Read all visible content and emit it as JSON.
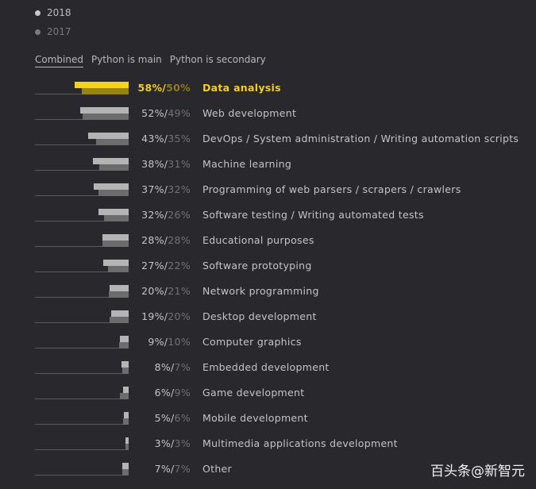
{
  "legend": [
    {
      "label": "2018",
      "color": "#c8c8c8"
    },
    {
      "label": "2017",
      "color": "#7a7a7a"
    }
  ],
  "tabs": [
    {
      "label": "Combined",
      "active": true
    },
    {
      "label": "Python is main",
      "active": false
    },
    {
      "label": "Python is secondary",
      "active": false
    }
  ],
  "watermark": "百头条@新智元",
  "chart_data": {
    "type": "bar",
    "orientation": "horizontal",
    "series": [
      {
        "name": "2018",
        "color": "#b4b4b4",
        "highlight_color": "#f5d31a"
      },
      {
        "name": "2017",
        "color": "#6c6c6c",
        "highlight_color": "#9a8212"
      }
    ],
    "categories": [
      "Data analysis",
      "Web development",
      "DevOps / System administration / Writing automation scripts",
      "Machine learning",
      "Programming of web parsers / scrapers / crawlers",
      "Software testing / Writing automated tests",
      "Educational purposes",
      "Software prototyping",
      "Network programming",
      "Desktop development",
      "Computer graphics",
      "Embedded development",
      "Game development",
      "Mobile development",
      "Multimedia applications development",
      "Other"
    ],
    "values_2018": [
      58,
      52,
      43,
      38,
      37,
      32,
      28,
      27,
      20,
      19,
      9,
      8,
      6,
      5,
      3,
      7
    ],
    "values_2017": [
      50,
      49,
      35,
      31,
      32,
      26,
      28,
      22,
      21,
      20,
      10,
      7,
      9,
      6,
      3,
      7
    ],
    "xlim": [
      0,
      100
    ],
    "highlighted": 0
  }
}
